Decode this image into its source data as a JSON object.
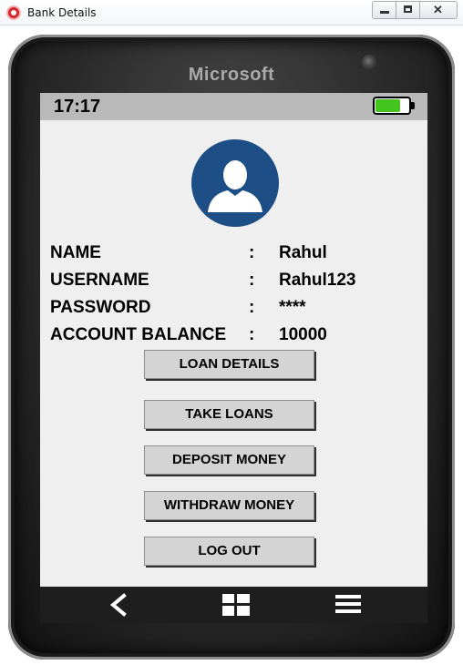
{
  "window": {
    "title": "Bank Details"
  },
  "phone": {
    "brand": "Microsoft",
    "status_bar": {
      "time": "17:17",
      "battery_level": 0.75,
      "battery_color": "#44c41e"
    }
  },
  "profile": {
    "avatar_icon": "user-silhouette-icon",
    "avatar_color": "#1d4f86",
    "fields": [
      {
        "label": "NAME",
        "separator": ":",
        "value": "Rahul"
      },
      {
        "label": "USERNAME",
        "separator": ":",
        "value": "Rahul123"
      },
      {
        "label": "PASSWORD",
        "separator": ":",
        "value": "****"
      },
      {
        "label": "ACCOUNT BALANCE",
        "separator": ":",
        "value": "10000"
      }
    ]
  },
  "actions": {
    "loan_details": "LOAN DETAILS",
    "take_loans": "TAKE LOANS",
    "deposit_money": "DEPOSIT MONEY",
    "withdraw_money": "WITHDRAW MONEY",
    "log_out": "LOG OUT"
  },
  "navbar": {
    "back_icon": "back-arrow-icon",
    "home_icon": "windows-home-icon",
    "menu_icon": "hamburger-menu-icon"
  }
}
